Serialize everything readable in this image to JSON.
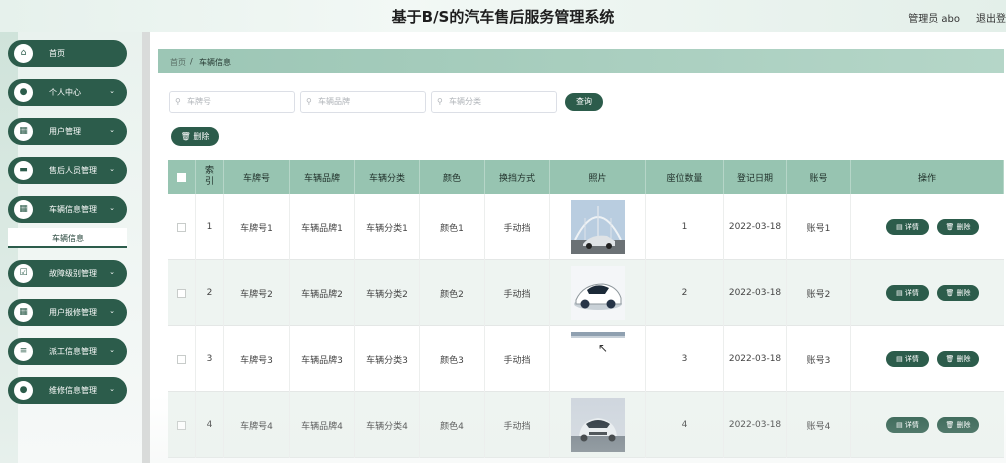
{
  "header": {
    "title": "基于B/S的汽车售后服务管理系统",
    "user": "管理员 abo",
    "logout": "退出登录"
  },
  "sidebar": {
    "items": [
      {
        "label": "首页",
        "icon": "home-icon",
        "glyph": "⌂",
        "has_arrow": false
      },
      {
        "label": "个人中心",
        "icon": "person-icon",
        "glyph": "●",
        "has_arrow": true
      },
      {
        "label": "用户管理",
        "icon": "grid-icon",
        "glyph": "▦",
        "has_arrow": true
      },
      {
        "label": "售后人员管理",
        "icon": "briefcase-icon",
        "glyph": "▬",
        "has_arrow": true
      },
      {
        "label": "车辆信息管理",
        "icon": "grid-icon",
        "glyph": "▦",
        "has_arrow": true
      },
      {
        "label": "故障级别管理",
        "icon": "checklist-icon",
        "glyph": "☑",
        "has_arrow": true
      },
      {
        "label": "用户报修管理",
        "icon": "grid-icon",
        "glyph": "▦",
        "has_arrow": true
      },
      {
        "label": "派工信息管理",
        "icon": "list-icon",
        "glyph": "≡",
        "has_arrow": true
      },
      {
        "label": "维修信息管理",
        "icon": "person-icon",
        "glyph": "●",
        "has_arrow": true
      }
    ],
    "active_sub": "车辆信息",
    "arrow_glyph": "⌄"
  },
  "breadcrumb": {
    "home": "首页",
    "separator": "/",
    "current": "车辆信息"
  },
  "search": {
    "icon_glyph": "⚲",
    "plate_placeholder": "车牌号",
    "brand_placeholder": "车辆品牌",
    "category_placeholder": "车辆分类",
    "query_label": "查询"
  },
  "actions": {
    "delete_label": "删除",
    "detail_label": "详情",
    "trash_glyph": "🗑",
    "doc_glyph": "▤"
  },
  "table": {
    "columns": [
      "索引",
      "车牌号",
      "车辆品牌",
      "车辆分类",
      "颜色",
      "换挡方式",
      "照片",
      "座位数量",
      "登记日期",
      "账号",
      "操作"
    ],
    "rows": [
      {
        "index": "1",
        "plate": "车牌号1",
        "brand": "车辆品牌1",
        "category": "车辆分类1",
        "color": "颜色1",
        "gear": "手动挡",
        "seats": "1",
        "date": "2022-03-18",
        "account": "账号1"
      },
      {
        "index": "2",
        "plate": "车牌号2",
        "brand": "车辆品牌2",
        "category": "车辆分类2",
        "color": "颜色2",
        "gear": "手动挡",
        "seats": "2",
        "date": "2022-03-18",
        "account": "账号2"
      },
      {
        "index": "3",
        "plate": "车牌号3",
        "brand": "车辆品牌3",
        "category": "车辆分类3",
        "color": "颜色3",
        "gear": "手动挡",
        "seats": "3",
        "date": "2022-03-18",
        "account": "账号3"
      },
      {
        "index": "4",
        "plate": "车牌号4",
        "brand": "车辆品牌4",
        "category": "车辆分类4",
        "color": "颜色4",
        "gear": "手动挡",
        "seats": "4",
        "date": "2022-03-18",
        "account": "账号4"
      }
    ]
  },
  "colors": {
    "accent": "#2c5c4b",
    "header_row": "#97c4b1",
    "breadcrumb_bar": "#9cc6b5"
  }
}
